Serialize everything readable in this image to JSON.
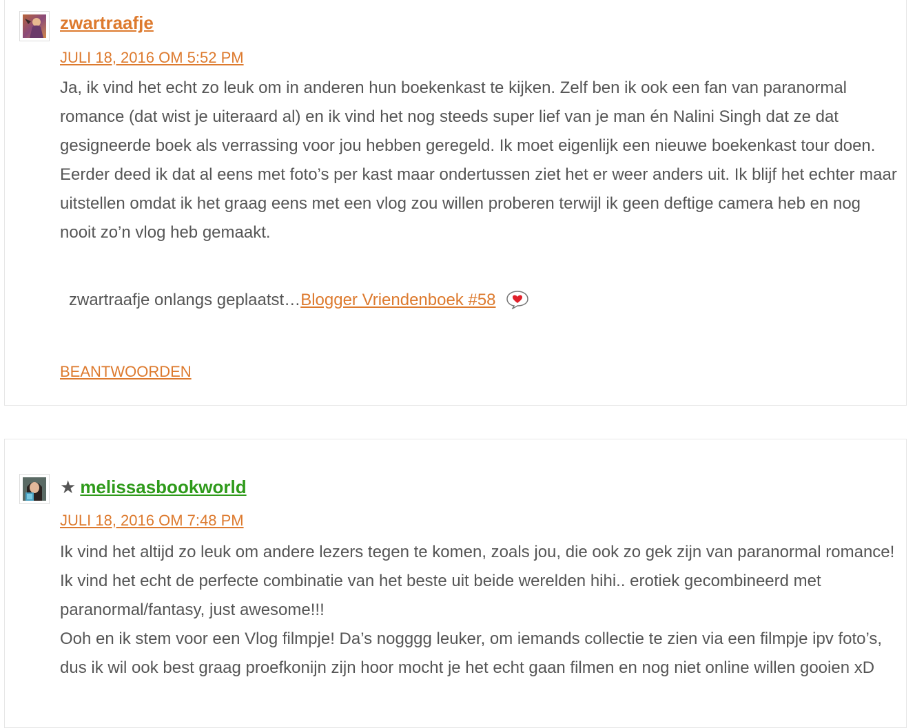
{
  "comments": [
    {
      "author": "zwartraafje",
      "starred": false,
      "date": "JULI 18, 2016 OM 5:52 PM",
      "paragraphs": [
        "Ja, ik vind het echt zo leuk om in anderen hun boekenkast te kijken. Zelf ben ik ook een fan van paranormal romance (dat wist je uiteraard al) en ik vind het nog steeds super lief van je man én Nalini Singh dat ze dat gesigneerde boek als verrassing voor jou hebben geregeld. Ik moet eigenlijk een nieuwe boekenkast tour doen. Eerder deed ik dat al eens met foto’s per kast maar ondertussen ziet het er weer anders uit. Ik blijf het echter maar uitstellen omdat ik het graag eens met een vlog zou willen proberen terwijl ik geen deftige camera heb en nog nooit zo’n vlog heb gemaakt."
      ],
      "latest_post_prefix": "zwartraafje onlangs geplaatst…",
      "latest_post_title": "Blogger Vriendenboek #58",
      "reply_label": "BEANTWOORDEN",
      "author_color": "#dd7a2e"
    },
    {
      "author": "melissasbookworld",
      "starred": true,
      "star_glyph": "★",
      "date": "JULI 18, 2016 OM 7:48 PM",
      "paragraphs": [
        "Ik vind het altijd zo leuk om andere lezers tegen te komen, zoals jou, die ook zo gek zijn van paranormal romance! Ik vind het echt de perfecte combinatie van het beste uit beide werelden hihi.. erotiek gecombineerd met paranormal/fantasy, just awesome!!!",
        "Ooh en ik stem voor een Vlog filmpje! Da’s nogggg leuker, om iemands collectie te zien via een filmpje ipv foto’s, dus ik wil ook best graag proefkonijn zijn hoor mocht je het echt gaan filmen en nog niet online willen gooien xD"
      ],
      "author_color": "#2e9a1a"
    }
  ],
  "colors": {
    "link": "#dd7a2e",
    "text": "#555555",
    "border": "#e6e6e6",
    "heart": "#e0202a"
  },
  "icons": {
    "latest_post_icon": "heart-speech-bubble-icon",
    "avatar_1": "avatar-image",
    "avatar_2": "avatar-image"
  }
}
